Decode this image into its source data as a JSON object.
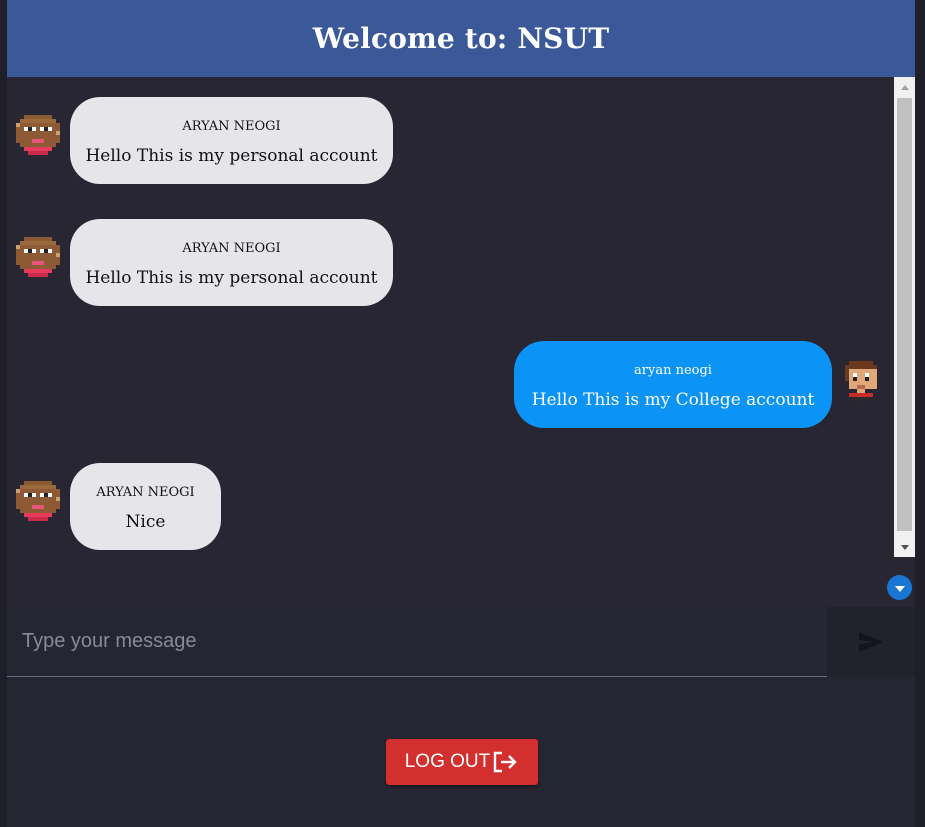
{
  "header": {
    "title": "Welcome to: NSUT"
  },
  "messages": [
    {
      "sender": "ARYAN NEOGI",
      "text": "Hello This is my personal account",
      "side": "left"
    },
    {
      "sender": "ARYAN NEOGI",
      "text": "Hello This is my personal account",
      "side": "left"
    },
    {
      "sender": "aryan neogi",
      "text": "Hello This is my College account",
      "side": "right"
    },
    {
      "sender": "ARYAN NEOGI",
      "text": "Nice",
      "side": "left"
    }
  ],
  "composer": {
    "placeholder": "Type your message",
    "value": ""
  },
  "logout": {
    "label": "LOG OUT"
  },
  "icons": {
    "send": "send-icon",
    "logout": "logout-icon",
    "scroll_down": "chevron-down-icon",
    "avatar": "pixel-avatar"
  },
  "colors": {
    "header_bg": "#3b5998",
    "bubble_other": "#e6e5ea",
    "bubble_self": "#0b93f6",
    "logout_bg": "#d32f2f",
    "scroll_button": "#1976d2"
  }
}
